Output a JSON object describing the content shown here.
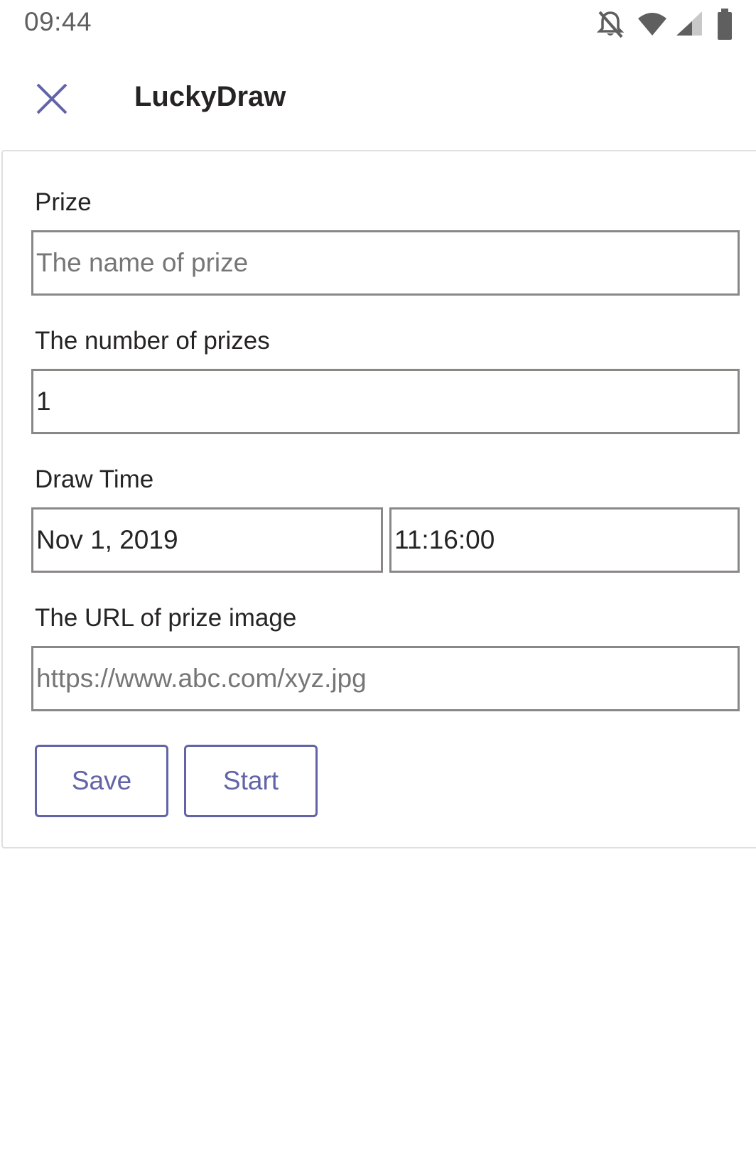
{
  "status_bar": {
    "time": "09:44",
    "icons": [
      "notifications-off-icon",
      "wifi-icon",
      "signal-icon",
      "battery-icon"
    ]
  },
  "header": {
    "close_icon": "close-icon",
    "title": "LuckyDraw"
  },
  "form": {
    "prize": {
      "label": "Prize",
      "value": "",
      "placeholder": "The name of prize"
    },
    "number_of_prizes": {
      "label": "The number of prizes",
      "value": "1"
    },
    "draw_time": {
      "label": "Draw Time",
      "date": "Nov 1, 2019",
      "time": "11:16:00"
    },
    "image_url": {
      "label": "The URL of prize image",
      "value": "",
      "placeholder": "https://www.abc.com/xyz.jpg"
    },
    "buttons": {
      "save": "Save",
      "start": "Start"
    }
  },
  "colors": {
    "accent": "#6264a7",
    "input_border": "#8a8886",
    "text": "#252423",
    "placeholder": "#767676",
    "status_icons": "#5f5f5f"
  }
}
